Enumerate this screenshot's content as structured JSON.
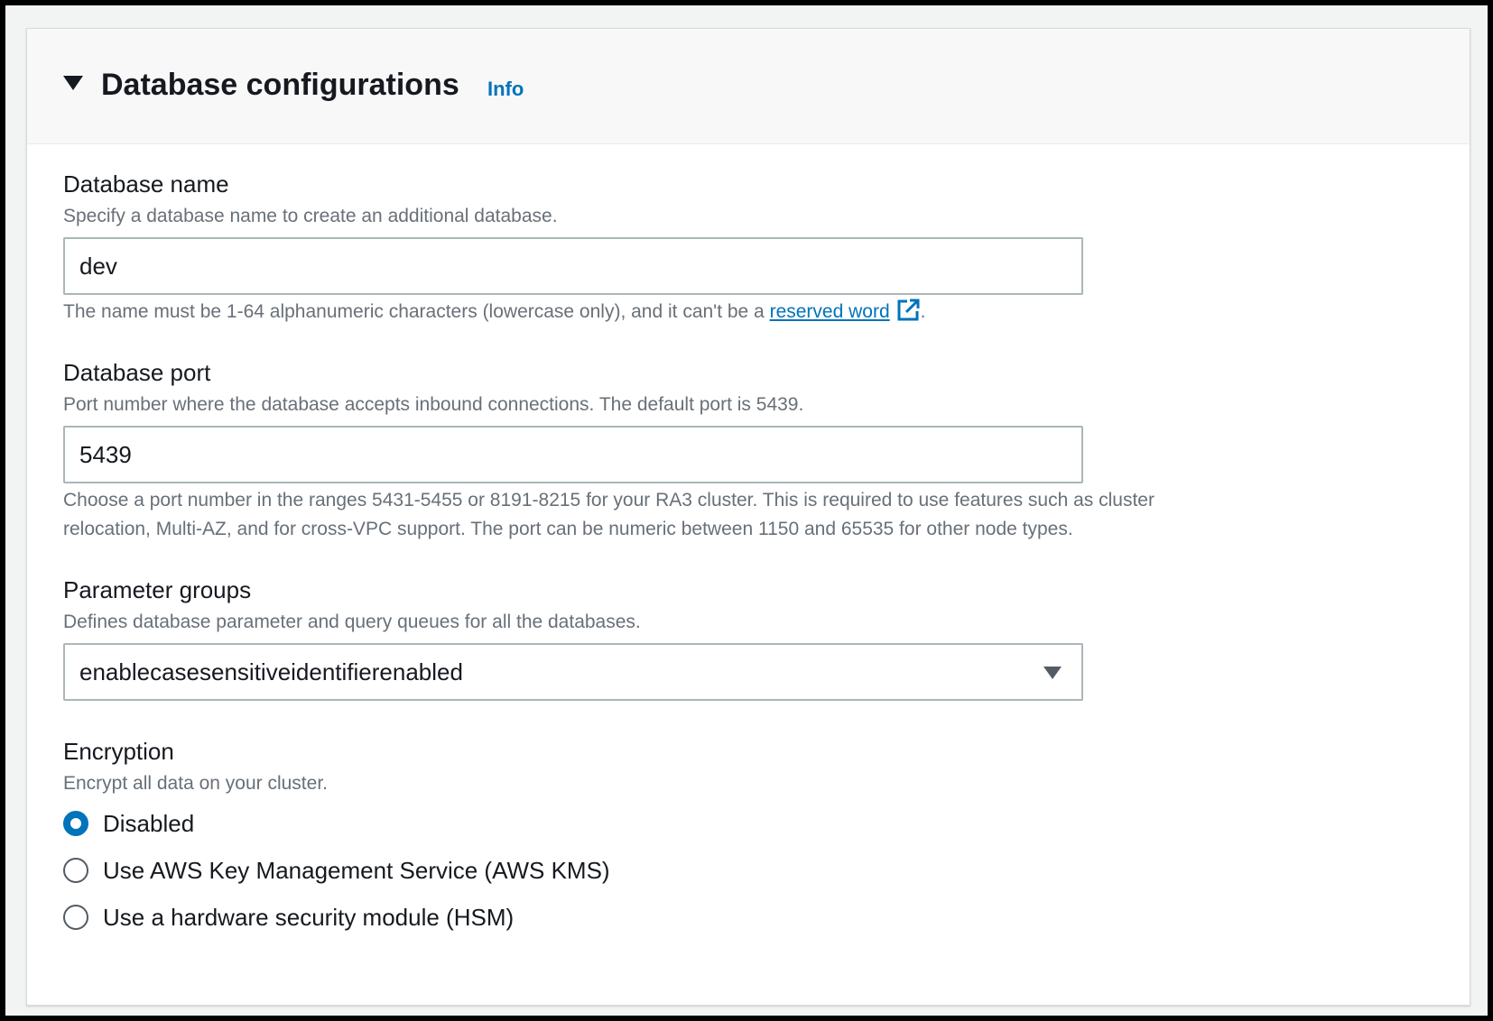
{
  "section": {
    "title": "Database configurations",
    "info_label": "Info"
  },
  "database_name": {
    "label": "Database name",
    "description": "Specify a database name to create an additional database.",
    "value": "dev",
    "hint_prefix": "The name must be 1-64 alphanumeric characters (lowercase only), and it can't be a ",
    "hint_link": "reserved word",
    "hint_suffix": ".",
    "link_icon": "external-link-icon"
  },
  "database_port": {
    "label": "Database port",
    "description": "Port number where the database accepts inbound connections. The default port is 5439.",
    "value": "5439",
    "hint_line1": "Choose a port number in the ranges 5431-5455 or 8191-8215 for your RA3 cluster. This is required to use features such as cluster",
    "hint_line2": "relocation, Multi-AZ, and for cross-VPC support. The port can be numeric between 1150 and 65535 for other node types."
  },
  "parameter_groups": {
    "label": "Parameter groups",
    "description": "Defines database parameter and query queues for all the databases.",
    "selected": "enablecasesensitiveidentifierenabled",
    "caret_icon": "caret-down-icon"
  },
  "encryption": {
    "label": "Encryption",
    "description": "Encrypt all data on your cluster.",
    "options": [
      {
        "label": "Disabled",
        "checked": true
      },
      {
        "label": "Use AWS Key Management Service (AWS KMS)",
        "checked": false
      },
      {
        "label": "Use a hardware security module (HSM)",
        "checked": false
      }
    ]
  },
  "colors": {
    "link": "#0073bb",
    "text": "#16191f",
    "secondary_text": "#687078",
    "border": "#aab7b8",
    "header_bg": "#f8f8f8"
  }
}
